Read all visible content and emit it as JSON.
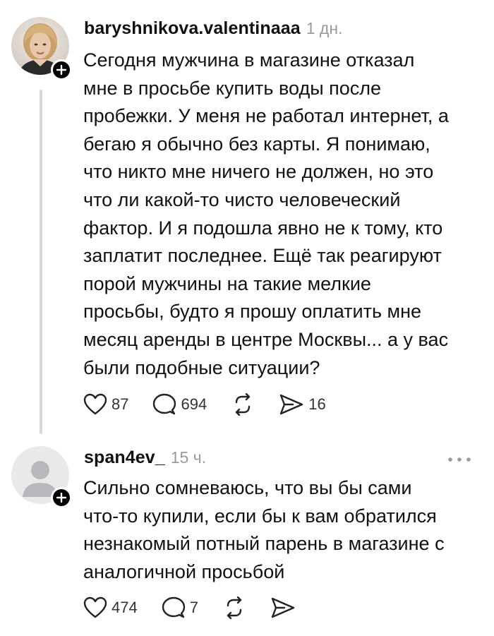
{
  "post": {
    "username": "baryshnikova.valentinaaa",
    "timestamp": "1 дн.",
    "text": "Сегодня мужчина в магазине отказал\nмне в просьбе купить воды после\nпробежки. У меня не работал интернет, а\nбегаю я обычно без карты. Я понимаю,\nчто никто мне ничего не должен, но это\nчто ли какой-то чисто человеческий\nфактор. И я подошла явно не к тому, кто\nзаплатит последнее. Ещё так реагируют\nпорой мужчины на такие мелкие\nпросьбы, будто я прошу оплатить мне\nмесяц аренды в центре Москвы... а у вас\nбыли подобные ситуации?",
    "likes": "87",
    "comments": "694",
    "shares": "16",
    "icons": [
      "heart-icon",
      "comment-icon",
      "repost-icon",
      "share-icon",
      "plus-icon"
    ]
  },
  "reply": {
    "username": "span4ev_",
    "timestamp": "15 ч.",
    "text": "Сильно сомневаюсь, что вы бы сами\nчто-то купили, если бы к вам обратился\nнезнакомый потный парень в магазине с\nаналогичной просьбой",
    "likes": "474",
    "comments": "7",
    "icons": [
      "more-icon",
      "heart-icon",
      "comment-icon",
      "repost-icon",
      "share-icon",
      "plus-icon"
    ]
  },
  "colors": {
    "text": "#111111",
    "muted": "#9a9a9a",
    "thread_line": "#d8d8d8",
    "badge": "#000000",
    "default_avatar_bg": "#e9e9ea",
    "default_avatar_fg": "#b8b8bc"
  }
}
